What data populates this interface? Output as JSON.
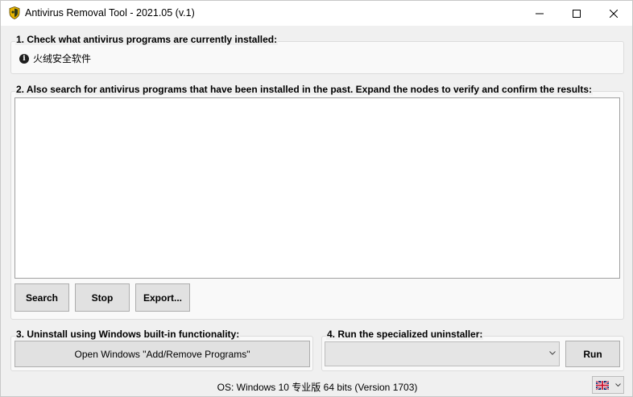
{
  "window": {
    "title": "Antivirus Removal Tool - 2021.05 (v.1)",
    "app_icon": "shield-icon",
    "controls": [
      "minimize-icon",
      "maximize-icon",
      "close-icon"
    ]
  },
  "section1": {
    "title": "1. Check what antivirus programs are currently installed:",
    "installed": [
      {
        "icon": "info-icon",
        "name": "火绒安全软件"
      }
    ]
  },
  "section2": {
    "title": "2. Also search for antivirus programs that have been installed in the past. Expand the nodes to verify and confirm the results:",
    "buttons": {
      "search": "Search",
      "stop": "Stop",
      "export": "Export..."
    }
  },
  "section3": {
    "title": "3. Uninstall using Windows built-in functionality:",
    "button": "Open Windows \"Add/Remove Programs\""
  },
  "section4": {
    "title": "4. Run the specialized uninstaller:",
    "selected": "",
    "run": "Run"
  },
  "status": {
    "os": "OS: Windows 10 专业版 64 bits (Version 1703)",
    "language_icon": "uk-flag-icon"
  }
}
